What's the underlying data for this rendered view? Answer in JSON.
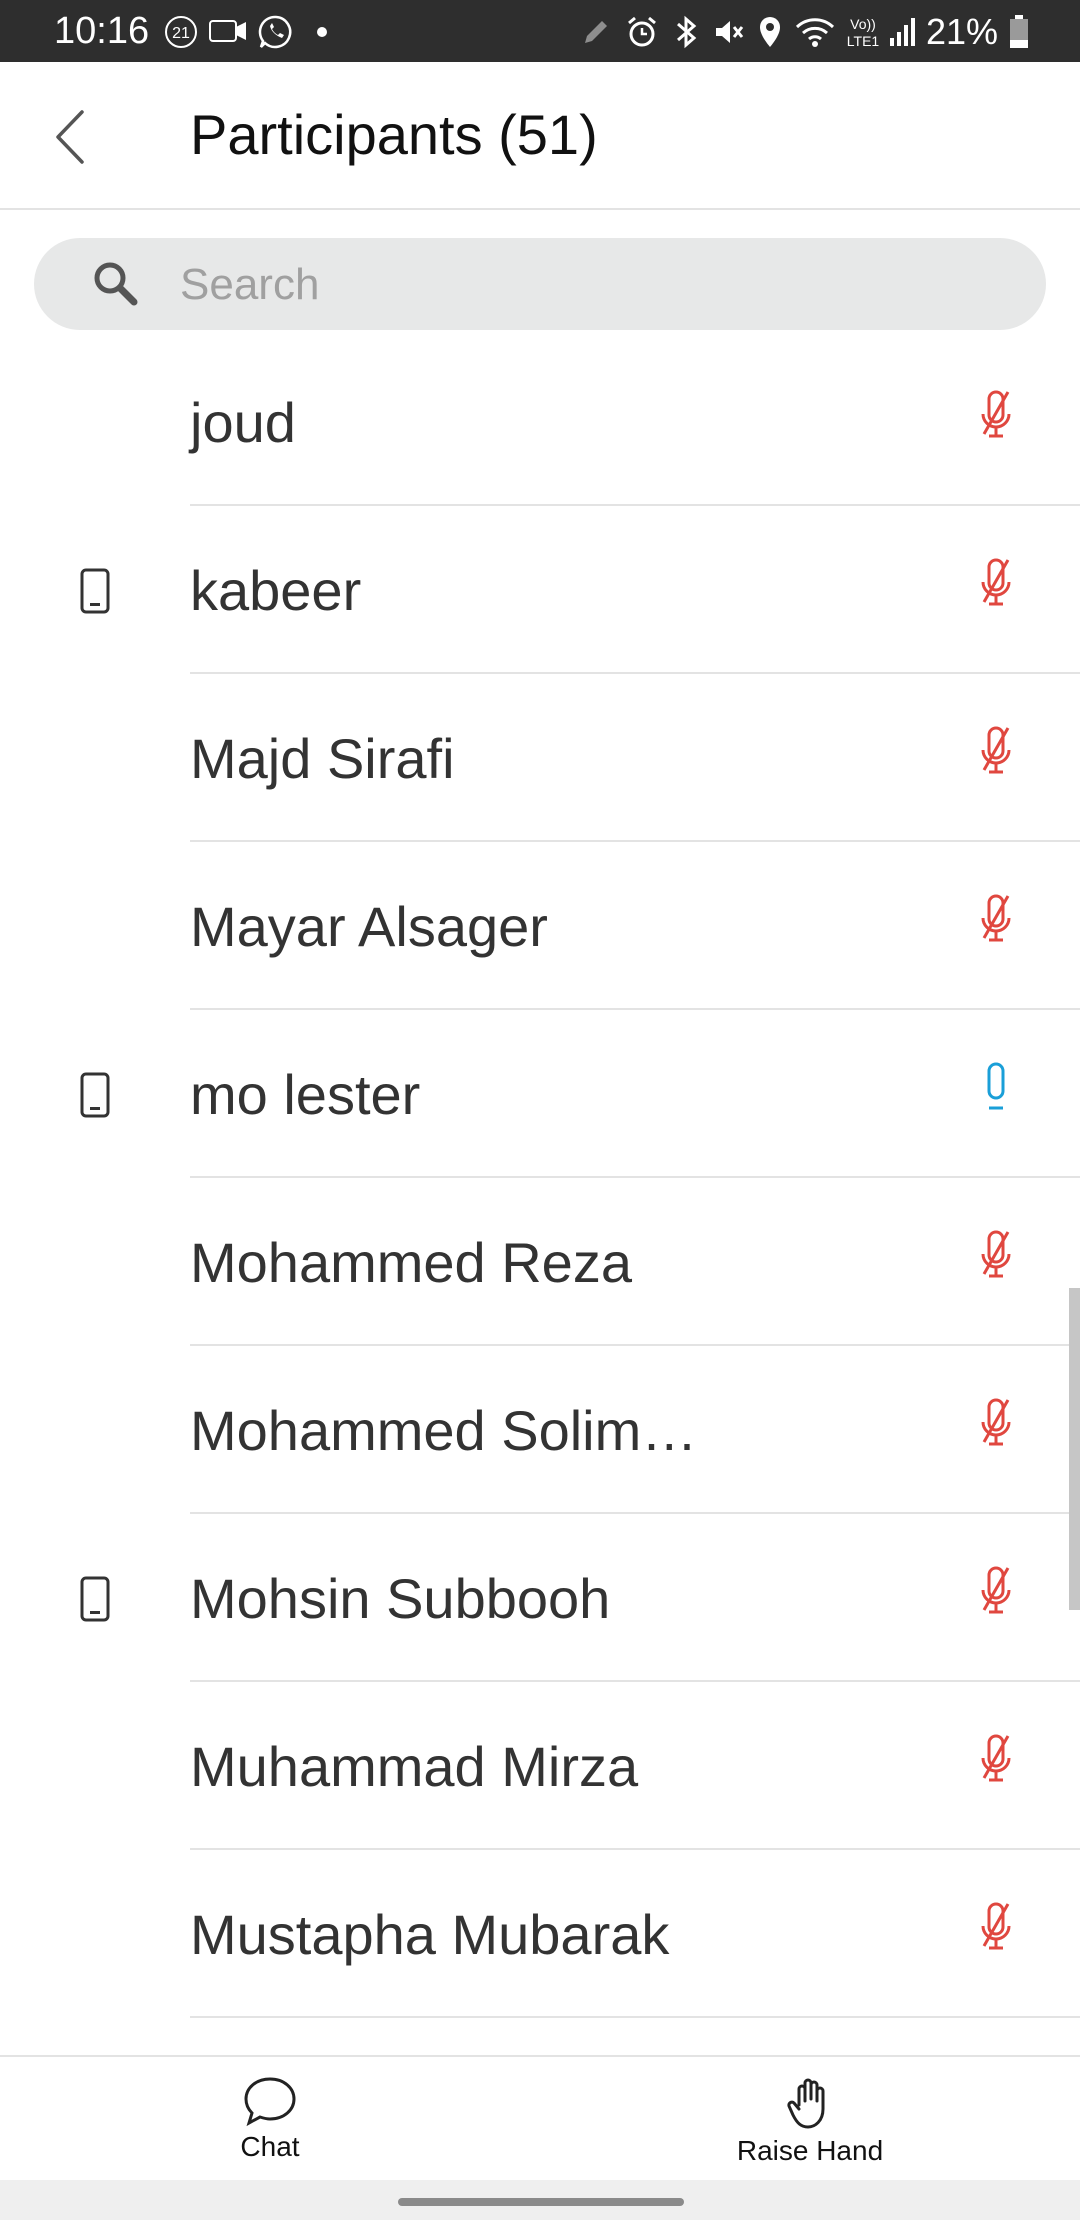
{
  "status_bar": {
    "time": "10:16",
    "notification_badge": "21",
    "battery_percent": "21%",
    "network_label_top": "Vo))",
    "network_label_bottom": "LTE1"
  },
  "header": {
    "title": "Participants (51)",
    "back_icon": "chevron-left-icon"
  },
  "search": {
    "placeholder": "Search",
    "value": ""
  },
  "colors": {
    "muted_mic": "#e0473f",
    "active_mic": "#1a9fd8",
    "text": "#333333"
  },
  "participants": [
    {
      "name": "joud",
      "device": "none",
      "mic": "muted"
    },
    {
      "name": "kabeer",
      "device": "phone",
      "mic": "muted"
    },
    {
      "name": "Majd Sirafi",
      "device": "none",
      "mic": "muted"
    },
    {
      "name": "Mayar Alsager",
      "device": "none",
      "mic": "muted"
    },
    {
      "name": "mo lester",
      "device": "phone",
      "mic": "unmuted"
    },
    {
      "name": "Mohammed Reza",
      "device": "none",
      "mic": "muted"
    },
    {
      "name": "Mohammed Solim…",
      "device": "none",
      "mic": "muted"
    },
    {
      "name": "Mohsin Subbooh",
      "device": "phone",
      "mic": "muted"
    },
    {
      "name": "Muhammad Mirza",
      "device": "none",
      "mic": "muted"
    },
    {
      "name": "Mustapha Mubarak",
      "device": "none",
      "mic": "muted"
    }
  ],
  "bottom_bar": {
    "chat_label": "Chat",
    "raise_hand_label": "Raise Hand"
  }
}
